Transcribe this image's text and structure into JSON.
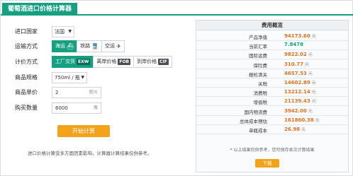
{
  "title": "葡萄酒进口价格计算器",
  "form": {
    "country_label": "进口国家",
    "country_value": "法国",
    "transport_label": "运输方式",
    "transport_options": [
      "海运",
      "铁路",
      "空运"
    ],
    "transport_active": "海运",
    "price_label": "计价方式",
    "price_options": [
      {
        "label": "工厂交货",
        "tag": "EXW"
      },
      {
        "label": "离岸价格",
        "tag": "FOB"
      },
      {
        "label": "到岸价格",
        "tag": "CIF"
      }
    ],
    "spec_label": "商品规格",
    "spec_value": "750ml / 瓶",
    "unit_price_label": "商品单价",
    "unit_price_value": "2",
    "unit_price_unit": "欧元",
    "qty_label": "购买数量",
    "qty_value": "6000",
    "qty_unit": "瓶",
    "calc_button": "开始计算",
    "note": "进口价格计算受多方面因素影响，计算器计算结果仅供参考。"
  },
  "results": {
    "header": "费用概览",
    "rows": [
      {
        "k": "产品净值",
        "v": "94173.60",
        "u": "元"
      },
      {
        "k": "当前汇率",
        "v": "7.8478",
        "u": ""
      },
      {
        "k": "国际运费",
        "v": "9822.02",
        "u": "元"
      },
      {
        "k": "保险费",
        "v": "310.77",
        "u": "元"
      },
      {
        "k": "报检清关",
        "v": "4657.53",
        "u": "元"
      },
      {
        "k": "关税",
        "v": "14602.89",
        "u": "元"
      },
      {
        "k": "消费税",
        "v": "13212.14",
        "u": "元"
      },
      {
        "k": "增值税",
        "v": "21139.43",
        "u": "元"
      },
      {
        "k": "国内物流费",
        "v": "3942.00",
        "u": "元"
      },
      {
        "k": "总体成本预估",
        "v": "161860.38",
        "u": "元"
      },
      {
        "k": "单瓶成本",
        "v": "26.98",
        "u": "元"
      }
    ],
    "note": "* 以上结果仅供参考，您可保存本次计算结果",
    "download": "下载"
  }
}
